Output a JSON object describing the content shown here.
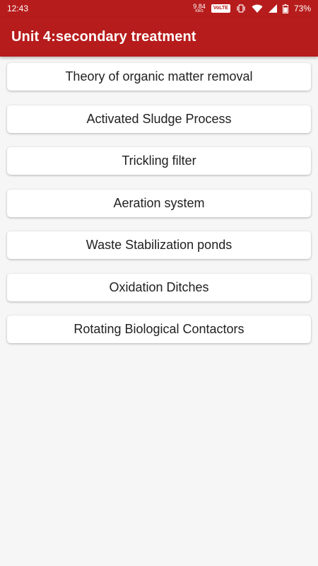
{
  "status_bar": {
    "time": "12:43",
    "net_speed_value": "9.84",
    "net_speed_unit": "KB/S",
    "volte": "VoLTE",
    "battery": "73%",
    "icons": [
      "vibrate-icon",
      "wifi-icon",
      "signal-icon",
      "battery-icon"
    ]
  },
  "app_bar": {
    "title": "Unit 4:secondary treatment"
  },
  "topics": [
    "Theory of organic matter removal",
    "Activated Sludge Process",
    "Trickling filter",
    "Aeration system",
    "Waste Stabilization ponds",
    "Oxidation Ditches",
    "Rotating Biological Contactors"
  ],
  "colors": {
    "primary": "#b71c1c",
    "background": "#f6f6f6",
    "card": "#ffffff",
    "text": "#212121"
  }
}
